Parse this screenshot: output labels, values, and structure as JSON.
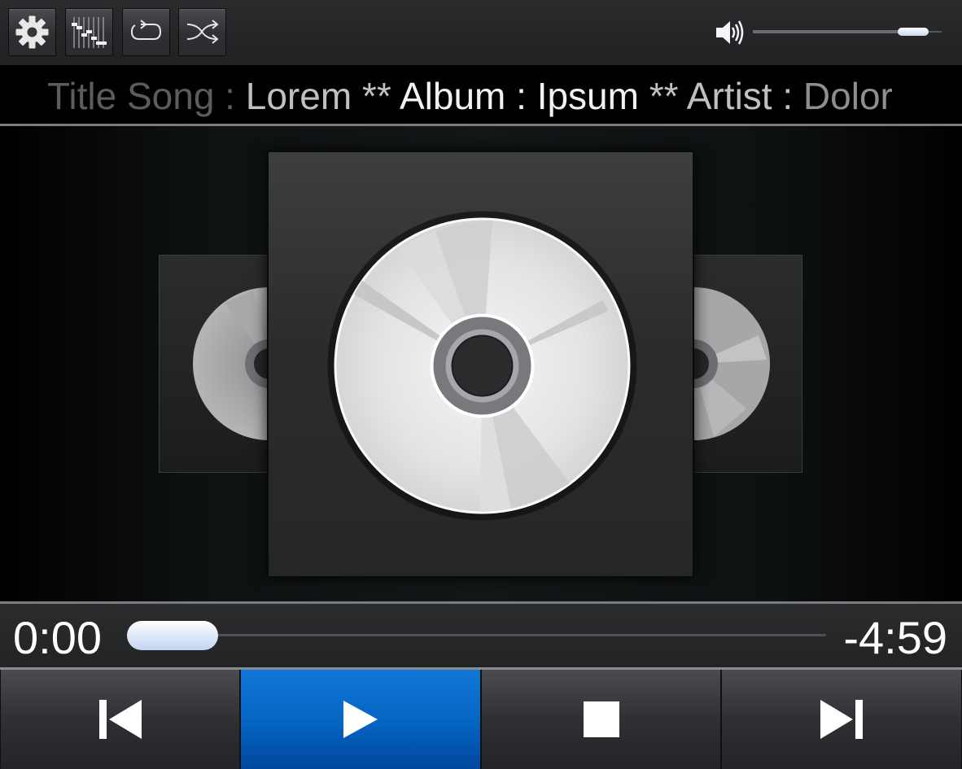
{
  "toolbar": {
    "buttons": [
      {
        "name": "settings",
        "icon": "gear-icon"
      },
      {
        "name": "equalizer",
        "icon": "equalizer-icon"
      },
      {
        "name": "repeat",
        "icon": "repeat-icon"
      },
      {
        "name": "shuffle",
        "icon": "shuffle-icon"
      }
    ],
    "volume": {
      "icon": "speaker-icon",
      "level": 0.92
    }
  },
  "marquee": {
    "parts": [
      {
        "text": "Title Song : ",
        "tone": "dim1"
      },
      {
        "text": "Lorem ** ",
        "tone": "mid"
      },
      {
        "text": "Album : Ipsum",
        "tone": "bright"
      },
      {
        "text": " ** Artist : ",
        "tone": "mid"
      },
      {
        "text": "Dolor",
        "tone": "dim2"
      }
    ]
  },
  "coverflow": {
    "items": [
      {
        "position": "left",
        "icon": "cd-disc-icon"
      },
      {
        "position": "center",
        "icon": "cd-disc-icon",
        "selected": true
      },
      {
        "position": "right",
        "icon": "cd-disc-icon"
      }
    ]
  },
  "playback": {
    "elapsed": "0:00",
    "remaining": "-4:59",
    "progress": 0.0
  },
  "transport": {
    "buttons": [
      {
        "name": "previous",
        "icon": "skip-previous-icon"
      },
      {
        "name": "play",
        "icon": "play-icon",
        "active": true
      },
      {
        "name": "stop",
        "icon": "stop-icon"
      },
      {
        "name": "next",
        "icon": "skip-next-icon"
      }
    ]
  },
  "colors": {
    "accent": "#0566c4",
    "knob": "#dce6f7",
    "background": "#1f2022"
  }
}
